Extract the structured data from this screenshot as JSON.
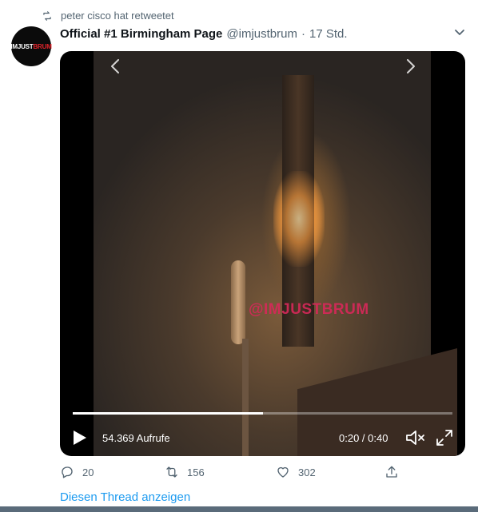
{
  "retweet": {
    "icon": "retweet-icon",
    "text": "peter cisco hat retweetet"
  },
  "tweet": {
    "avatar": {
      "logo_text_a": "IMJUST",
      "logo_text_b": "BRUM",
      "logo_color": "#e0242b"
    },
    "author_name": "Official #1 Birmingham Page",
    "handle": "@imjustbrum",
    "separator": "·",
    "time": "17 Std.",
    "menu_icon": "chevron-down-icon"
  },
  "media": {
    "watermark": "@IMJUSTBRUM",
    "views": "54.369 Aufrufe",
    "current_time": "0:20",
    "time_separator": " / ",
    "duration": "0:40",
    "progress": 0.5,
    "icons": [
      "chevron-left-icon",
      "chevron-right-icon",
      "play-icon",
      "volume-icon",
      "fullscreen-icon"
    ]
  },
  "actions": {
    "reply_count": "20",
    "retweet_count": "156",
    "like_count": "302",
    "icons": [
      "reply-icon",
      "retweet-icon",
      "heart-icon",
      "share-icon"
    ]
  },
  "thread_link": "Diesen Thread anzeigen",
  "colors": {
    "link": "#1d9bf0",
    "secondary_text": "#536471",
    "watermark": "#d8285a"
  }
}
